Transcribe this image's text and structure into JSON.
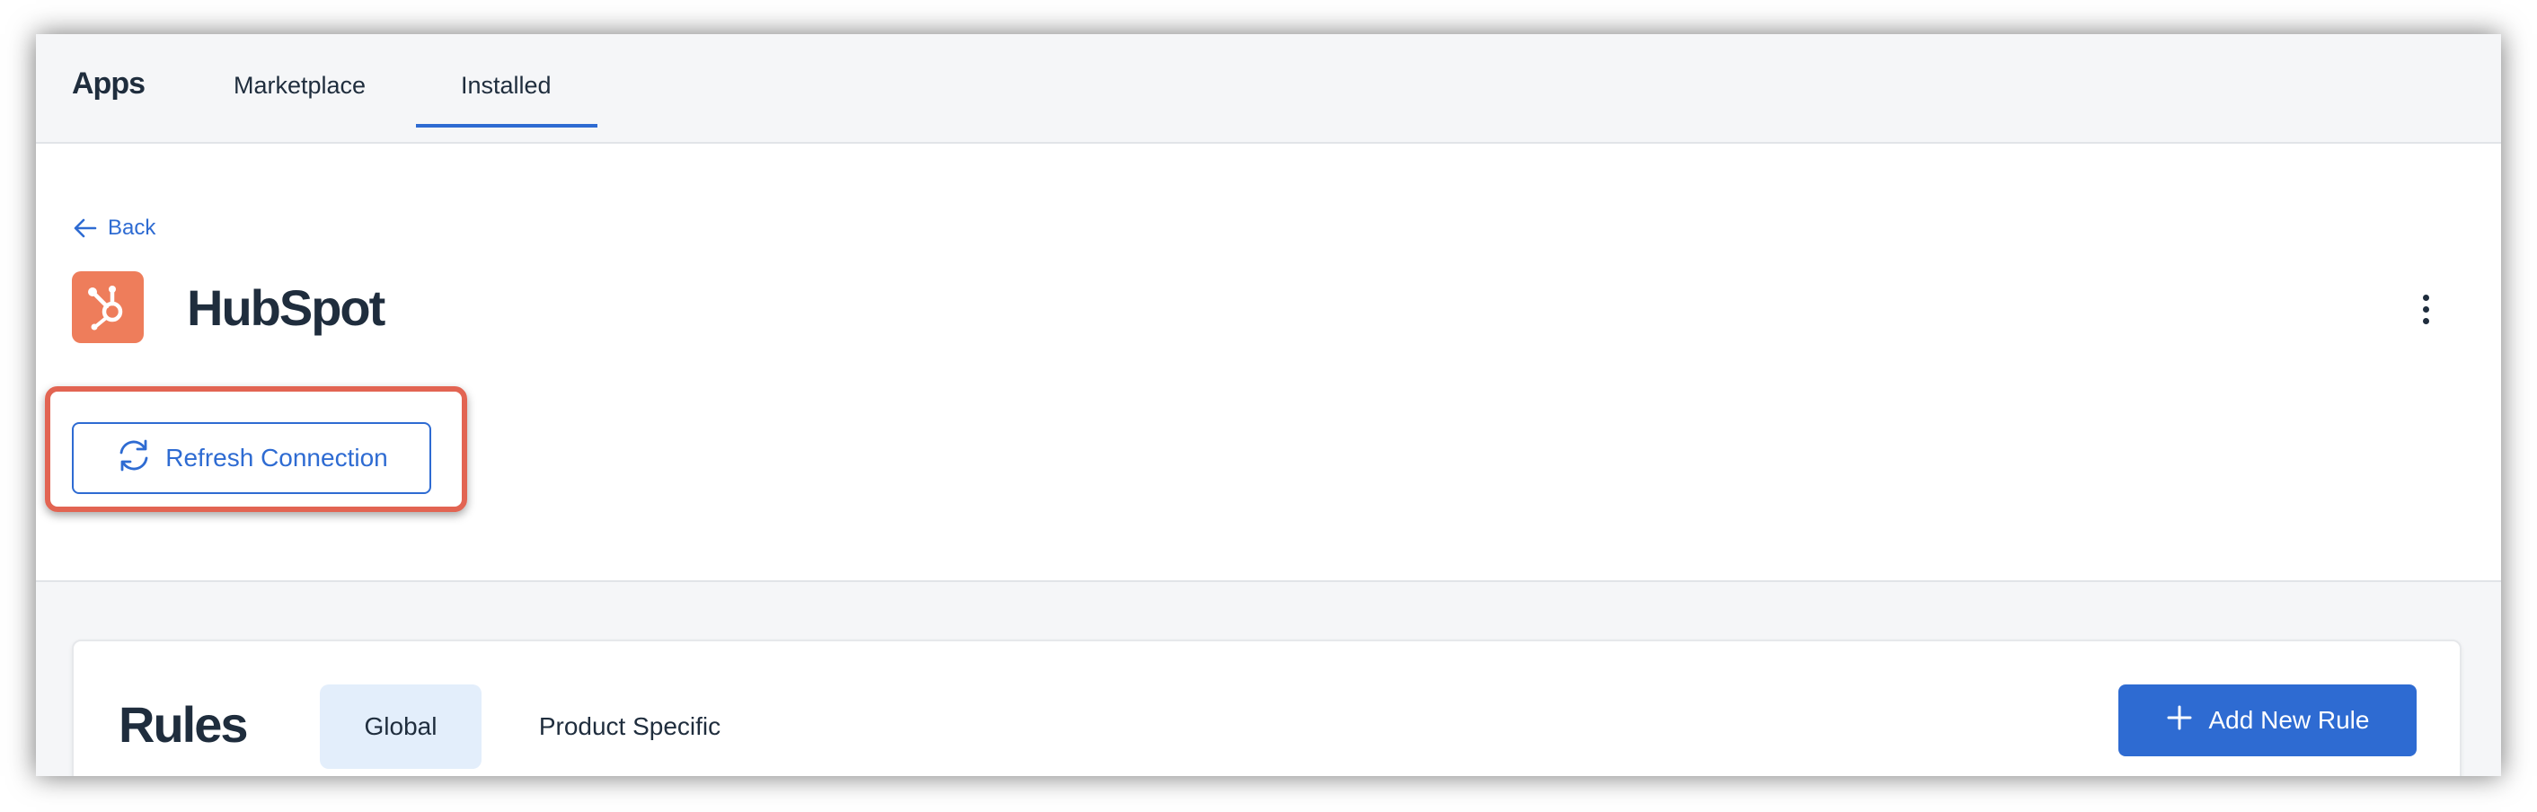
{
  "topnav": {
    "brand": "Apps",
    "tabs": [
      {
        "label": "Marketplace",
        "active": false
      },
      {
        "label": "Installed",
        "active": true
      }
    ]
  },
  "header": {
    "back_label": "Back",
    "app_name": "HubSpot",
    "logo_icon": "hubspot-logo-icon",
    "refresh_label": "Refresh Connection"
  },
  "rules": {
    "title": "Rules",
    "tabs": [
      {
        "label": "Global",
        "active": true
      },
      {
        "label": "Product Specific",
        "active": false
      }
    ],
    "add_button_label": "Add New Rule"
  },
  "colors": {
    "accent": "#2e6bd2",
    "hubspot": "#ee7d5b",
    "highlight": "#e26452",
    "tab_active_bg": "#e3eefb"
  }
}
